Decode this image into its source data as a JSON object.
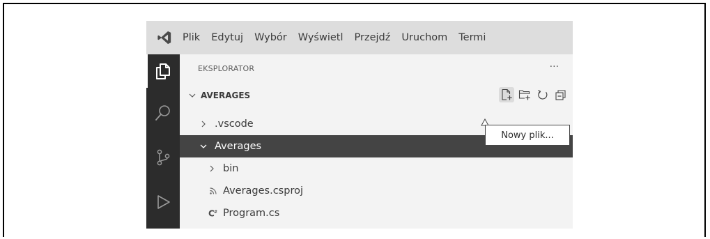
{
  "menu": {
    "items": [
      "Plik",
      "Edytuj",
      "Wybór",
      "Wyświetl",
      "Przejdź",
      "Uruchom",
      "Termi"
    ]
  },
  "explorer": {
    "title": "EKSPLORATOR",
    "more": "···",
    "section": "AVERAGES",
    "tree": [
      {
        "label": ".vscode",
        "type": "folder",
        "expanded": false,
        "selected": false
      },
      {
        "label": "Averages",
        "type": "folder",
        "expanded": true,
        "selected": true
      },
      {
        "label": "bin",
        "type": "folder",
        "expanded": false,
        "selected": false
      },
      {
        "label": "Averages.csproj",
        "type": "file",
        "icon": "rss-icon",
        "selected": false
      },
      {
        "label": "Program.cs",
        "type": "file",
        "icon": "csharp-icon",
        "selected": false
      }
    ]
  },
  "tooltip": {
    "text": "Nowy plik..."
  },
  "colors": {
    "menubar": "#dddddd",
    "activitybar": "#2c2c2c",
    "sidebar": "#f3f3f3",
    "selection": "#444444",
    "logo": "#4a4a4a"
  }
}
